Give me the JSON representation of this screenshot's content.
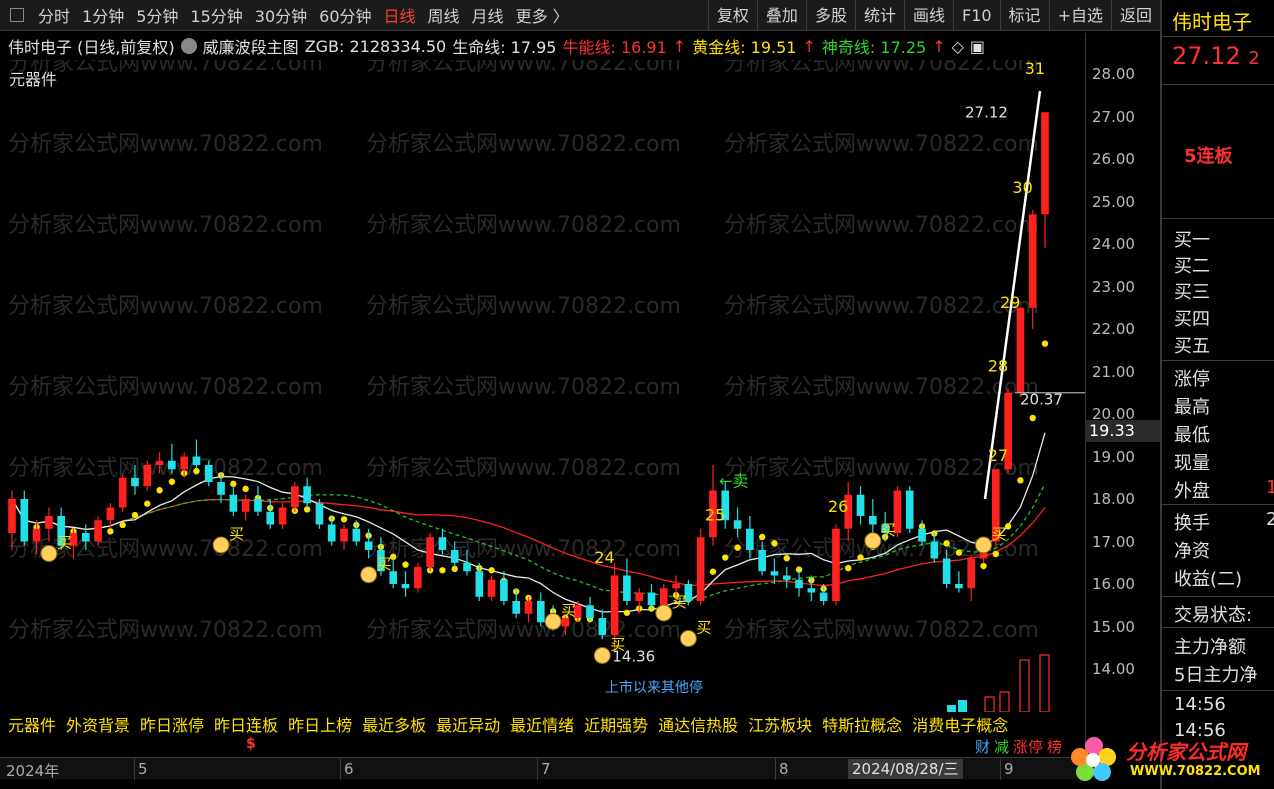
{
  "toolbar": {
    "periods": [
      "分时",
      "1分钟",
      "5分钟",
      "15分钟",
      "30分钟",
      "60分钟",
      "日线",
      "周线",
      "月线",
      "更多 〉"
    ],
    "active_period": "日线",
    "tools": [
      "复权",
      "叠加",
      "多股",
      "统计",
      "画线",
      "F10",
      "标记",
      "+自选",
      "返回"
    ]
  },
  "indicator": {
    "stock_label": "伟时电子 (日线,前复权)",
    "name": "威廉波段主图",
    "zgb": "ZGB: 2128334.50",
    "shengming": "生命线: 17.95",
    "niuneng": "牛能线: 16.91",
    "huangjin": "黄金线: 19.51",
    "shenqi": "神奇线: 17.25",
    "sub_label": "元器件",
    "colors": {
      "shengming": "#e0e0e0",
      "niuneng": "#ff3030",
      "huangjin": "#ffe300",
      "shenqi": "#32d232"
    }
  },
  "watermark": "分析家公式网www.70822.com",
  "annotations": {
    "price_high": "27.12",
    "price_low": "14.36",
    "price_mark": "20.37",
    "sell_label": "←卖",
    "buy_label": "买"
  },
  "concepts": [
    "元器件",
    "外资背景",
    "昨日涨停",
    "昨日连板",
    "昨日上榜",
    "最近多板",
    "最近异动",
    "最近情绪",
    "近期强势",
    "通达信热股",
    "江苏板块",
    "特斯拉概念",
    "消费电子概念"
  ],
  "overlay_text": "上市以来其他停",
  "badges": [
    {
      "text": "财",
      "color": "#4aa8ff"
    },
    {
      "text": "减",
      "color": "#32d232"
    },
    {
      "text": "涨停",
      "color": "#ff3030"
    },
    {
      "text": "榜",
      "color": "#ff3030"
    }
  ],
  "date_axis": {
    "ticks": [
      "2024年",
      "5",
      "6",
      "7",
      "8",
      "9"
    ],
    "cursor": "2024/08/28/三"
  },
  "price_axis": {
    "labels": [
      "28.00",
      "27.00",
      "26.00",
      "25.00",
      "24.00",
      "23.00",
      "22.00",
      "21.00",
      "20.00",
      "19.00",
      "18.00",
      "17.00",
      "16.00",
      "15.00",
      "14.00"
    ],
    "cursor": "19.33"
  },
  "right_panel": {
    "name": "伟时电子",
    "price": "27.12",
    "price_suffix": "2",
    "board": "5连板",
    "order_rows": [
      "买一",
      "买二",
      "买三",
      "买四",
      "买五"
    ],
    "stat_rows": [
      "涨停",
      "最高",
      "最低",
      "现量",
      "外盘"
    ],
    "stat_value_外盘": "1",
    "extra_rows": [
      "换手",
      "净资",
      "收益(二)"
    ],
    "turnover_value": "2",
    "trade_status": "交易状态:",
    "flow_rows": [
      "主力净额",
      "5日主力净"
    ],
    "times": [
      "14:56",
      "14:56"
    ]
  },
  "logo": {
    "title": "分析家公式网",
    "url": "WWW.70822.COM"
  },
  "chart_data": {
    "type": "candlestick",
    "y_range": [
      13.5,
      28.5
    ],
    "candles": [
      [
        17.2,
        18.2,
        16.8,
        18.0
      ],
      [
        18.0,
        18.2,
        16.9,
        17.0
      ],
      [
        17.0,
        17.5,
        16.7,
        17.3
      ],
      [
        17.3,
        17.8,
        17.0,
        17.6
      ],
      [
        17.6,
        17.8,
        16.8,
        16.9
      ],
      [
        16.9,
        17.3,
        16.6,
        17.2
      ],
      [
        17.2,
        17.4,
        16.8,
        17.0
      ],
      [
        17.0,
        17.6,
        16.9,
        17.5
      ],
      [
        17.5,
        17.9,
        17.3,
        17.8
      ],
      [
        17.8,
        18.6,
        17.7,
        18.5
      ],
      [
        18.5,
        18.8,
        18.1,
        18.3
      ],
      [
        18.3,
        18.9,
        18.2,
        18.8
      ],
      [
        18.8,
        19.1,
        18.6,
        18.9
      ],
      [
        18.9,
        19.3,
        18.6,
        18.7
      ],
      [
        18.7,
        19.1,
        18.5,
        19.0
      ],
      [
        19.0,
        19.4,
        18.7,
        18.8
      ],
      [
        18.8,
        18.9,
        18.3,
        18.4
      ],
      [
        18.4,
        18.6,
        17.9,
        18.1
      ],
      [
        18.1,
        18.3,
        17.6,
        17.7
      ],
      [
        17.7,
        18.1,
        17.5,
        18.0
      ],
      [
        18.0,
        18.3,
        17.6,
        17.7
      ],
      [
        17.7,
        18.0,
        17.3,
        17.4
      ],
      [
        17.4,
        17.9,
        17.3,
        17.8
      ],
      [
        17.8,
        18.4,
        17.7,
        18.3
      ],
      [
        18.3,
        18.5,
        17.8,
        17.9
      ],
      [
        17.9,
        18.0,
        17.3,
        17.4
      ],
      [
        17.4,
        17.6,
        16.9,
        17.0
      ],
      [
        17.0,
        17.4,
        16.8,
        17.3
      ],
      [
        17.3,
        17.5,
        16.9,
        17.0
      ],
      [
        17.0,
        17.3,
        16.6,
        16.8
      ],
      [
        16.8,
        17.1,
        16.2,
        16.3
      ],
      [
        16.3,
        16.6,
        15.9,
        16.0
      ],
      [
        16.0,
        16.3,
        15.7,
        15.9
      ],
      [
        15.9,
        16.5,
        15.8,
        16.4
      ],
      [
        16.4,
        17.2,
        16.3,
        17.1
      ],
      [
        17.1,
        17.3,
        16.7,
        16.8
      ],
      [
        16.8,
        17.0,
        16.4,
        16.5
      ],
      [
        16.5,
        16.8,
        16.2,
        16.3
      ],
      [
        16.3,
        16.5,
        15.6,
        15.7
      ],
      [
        15.7,
        16.2,
        15.6,
        16.1
      ],
      [
        16.1,
        16.3,
        15.5,
        15.6
      ],
      [
        15.6,
        15.9,
        15.2,
        15.3
      ],
      [
        15.3,
        15.7,
        15.1,
        15.6
      ],
      [
        15.6,
        15.8,
        15.0,
        15.1
      ],
      [
        15.1,
        15.5,
        14.9,
        15.0
      ],
      [
        15.0,
        15.3,
        14.8,
        15.2
      ],
      [
        15.2,
        15.6,
        15.1,
        15.5
      ],
      [
        15.5,
        15.7,
        15.1,
        15.2
      ],
      [
        15.2,
        15.4,
        14.7,
        14.8
      ],
      [
        14.8,
        16.5,
        14.4,
        16.2
      ],
      [
        16.2,
        16.6,
        15.5,
        15.6
      ],
      [
        15.6,
        15.9,
        15.3,
        15.8
      ],
      [
        15.8,
        16.0,
        15.4,
        15.5
      ],
      [
        15.5,
        16.0,
        15.4,
        15.9
      ],
      [
        15.9,
        16.2,
        15.6,
        16.0
      ],
      [
        16.0,
        16.1,
        15.5,
        15.6
      ],
      [
        15.6,
        17.3,
        15.5,
        17.1
      ],
      [
        17.1,
        18.8,
        16.9,
        18.2
      ],
      [
        18.2,
        18.4,
        17.3,
        17.5
      ],
      [
        17.5,
        17.8,
        17.1,
        17.3
      ],
      [
        17.3,
        17.6,
        16.6,
        16.8
      ],
      [
        16.8,
        17.0,
        16.2,
        16.3
      ],
      [
        16.3,
        16.6,
        16.0,
        16.2
      ],
      [
        16.2,
        16.4,
        15.9,
        16.1
      ],
      [
        16.1,
        16.3,
        15.7,
        15.9
      ],
      [
        15.9,
        16.2,
        15.6,
        15.8
      ],
      [
        15.8,
        16.0,
        15.5,
        15.6
      ],
      [
        15.6,
        17.4,
        15.5,
        17.3
      ],
      [
        17.3,
        18.4,
        17.0,
        18.1
      ],
      [
        18.1,
        18.3,
        17.4,
        17.6
      ],
      [
        17.6,
        18.0,
        17.2,
        17.4
      ],
      [
        17.4,
        17.7,
        17.0,
        17.2
      ],
      [
        17.2,
        18.3,
        17.1,
        18.2
      ],
      [
        18.2,
        18.3,
        17.2,
        17.3
      ],
      [
        17.3,
        17.5,
        16.9,
        17.0
      ],
      [
        17.0,
        17.2,
        16.5,
        16.6
      ],
      [
        16.6,
        16.8,
        15.9,
        16.0
      ],
      [
        16.0,
        16.3,
        15.8,
        15.9
      ],
      [
        15.9,
        16.7,
        15.6,
        16.6
      ],
      [
        16.6,
        17.1,
        16.5,
        17.0
      ],
      [
        17.0,
        18.7,
        16.9,
        18.7
      ],
      [
        18.7,
        20.6,
        18.6,
        20.5
      ],
      [
        20.5,
        22.5,
        20.4,
        22.5
      ],
      [
        22.5,
        24.8,
        22.0,
        24.7
      ],
      [
        24.7,
        27.1,
        23.9,
        27.1
      ]
    ]
  }
}
